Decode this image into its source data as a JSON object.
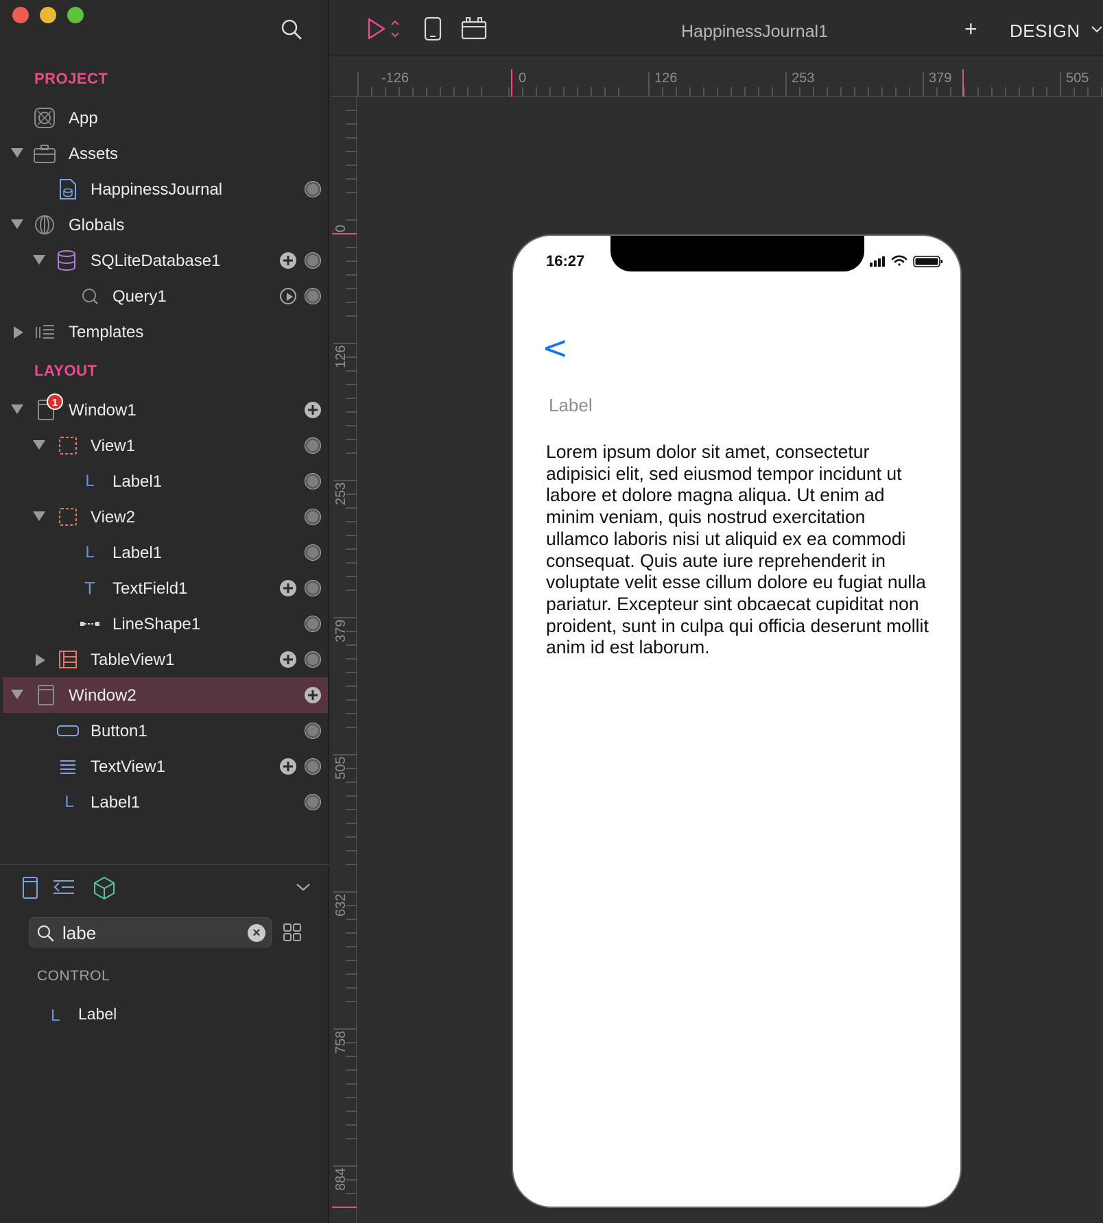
{
  "window": {
    "title": "HappinessJournal1",
    "mode": "DESIGN"
  },
  "project": {
    "section_label": "PROJECT",
    "items": [
      {
        "label": "App",
        "icon": "app-icon"
      },
      {
        "label": "Assets",
        "icon": "briefcase-icon"
      },
      {
        "label": "HappinessJournal",
        "icon": "database-file-icon"
      },
      {
        "label": "Globals",
        "icon": "globe-icon"
      },
      {
        "label": "SQLiteDatabase1",
        "icon": "database-icon"
      },
      {
        "label": "Query1",
        "icon": "query-icon"
      },
      {
        "label": "Templates",
        "icon": "templates-icon"
      }
    ]
  },
  "layout": {
    "section_label": "LAYOUT",
    "badge_count": "1",
    "items": [
      {
        "label": "Window1",
        "icon": "window-icon"
      },
      {
        "label": "View1",
        "icon": "view-icon"
      },
      {
        "label": "Label1",
        "icon": "label-icon"
      },
      {
        "label": "View2",
        "icon": "view-icon"
      },
      {
        "label": "Label1",
        "icon": "label-icon"
      },
      {
        "label": "TextField1",
        "icon": "textfield-icon"
      },
      {
        "label": "LineShape1",
        "icon": "lineshape-icon"
      },
      {
        "label": "TableView1",
        "icon": "tableview-icon"
      },
      {
        "label": "Window2",
        "icon": "window-icon"
      },
      {
        "label": "Button1",
        "icon": "button-icon"
      },
      {
        "label": "TextView1",
        "icon": "textview-icon"
      },
      {
        "label": "Label1",
        "icon": "label-icon"
      }
    ]
  },
  "library": {
    "search_value": "labe",
    "category": "CONTROL",
    "results": [
      {
        "label": "Label",
        "glyph": "L"
      }
    ]
  },
  "rulers": {
    "horizontal": [
      "-126",
      "0",
      "126",
      "253",
      "379",
      "505"
    ],
    "vertical": [
      "0",
      "126",
      "253",
      "379",
      "505",
      "632",
      "758",
      "884"
    ]
  },
  "device": {
    "status_time": "16:27",
    "back_glyph": "<",
    "label_text": "Label",
    "body_text": "Lorem ipsum dolor sit amet, consectetur adipisici elit, sed eiusmod tempor incidunt ut labore et dolore magna aliqua. Ut enim ad minim veniam, quis nostrud exercitation ullamco laboris nisi ut aliquid ex ea commodi consequat. Quis aute iure reprehenderit in voluptate velit esse cillum dolore eu fugiat nulla pariatur. Excepteur sint obcaecat cupiditat non proident, sunt in culpa qui officia deserunt mollit anim id est laborum."
  },
  "toolbar": {
    "add_glyph": "+"
  },
  "colors": {
    "accent": "#ec4a8d",
    "link_blue": "#1677e9",
    "selection": "#56353f",
    "badge": "#d6302f"
  }
}
